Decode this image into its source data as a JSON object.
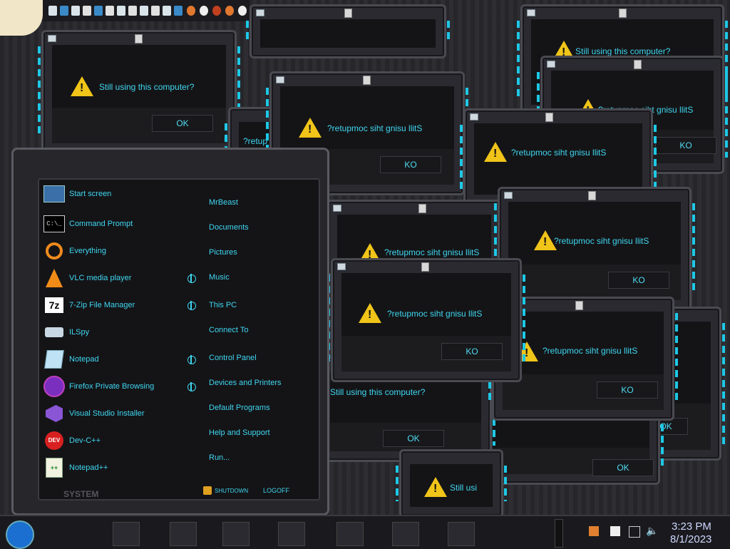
{
  "dialogs": {
    "message": "Still using this computer?",
    "message_mirrored": "?retupmoc siht gnisu llitS",
    "message_truncated": "Still usi",
    "message_fragment": "?retup",
    "ok_label": "OK",
    "ok_label_mirrored": "KO"
  },
  "start_menu": {
    "left_items": [
      {
        "label": "Start screen",
        "icon": "start-screen-icon"
      },
      {
        "label": "Command Prompt",
        "icon": "command-prompt-icon"
      },
      {
        "label": "Everything",
        "icon": "search-icon"
      },
      {
        "label": "VLC media player",
        "icon": "vlc-cone-icon"
      },
      {
        "label": "7-Zip File Manager",
        "icon": "7zip-icon"
      },
      {
        "label": "ILSpy",
        "icon": "ilspy-icon"
      },
      {
        "label": "Notepad",
        "icon": "notepad-icon"
      },
      {
        "label": "Firefox Private Browsing",
        "icon": "firefox-private-icon"
      },
      {
        "label": "Visual Studio Installer",
        "icon": "visual-studio-icon"
      },
      {
        "label": "Dev-C++",
        "icon": "devcpp-icon"
      },
      {
        "label": "Notepad++",
        "icon": "notepadpp-icon"
      }
    ],
    "right_items": [
      "MrBeast",
      "Documents",
      "Pictures",
      "Music",
      "This PC",
      "Connect To",
      "Control Panel",
      "Devices and Printers",
      "Default Programs",
      "Help and Support",
      "Run..."
    ],
    "shutdown_label": "SHUTDOWN",
    "logoff_label": "LOGOFF",
    "system_label": "SYSTEM"
  },
  "taskbar": {
    "time": "3:23 PM",
    "date": "8/1/2023"
  },
  "colors": {
    "accent": "#3fd6f0",
    "warning": "#f0c419",
    "frame": "#4a4a52"
  }
}
